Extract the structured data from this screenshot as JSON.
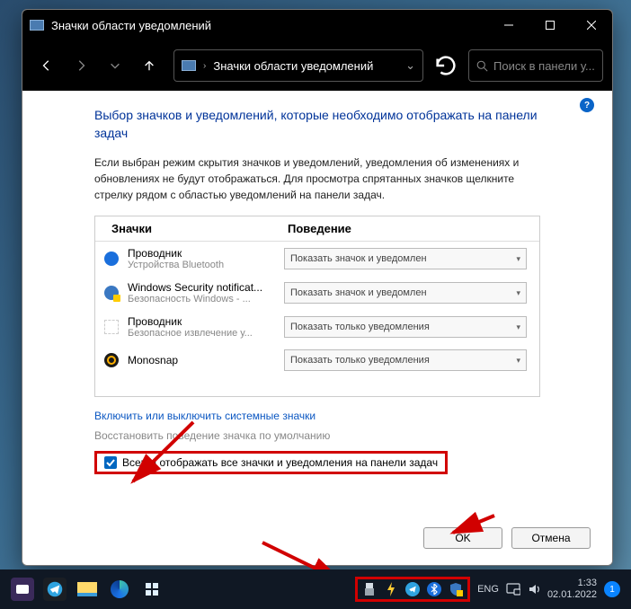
{
  "window": {
    "title": "Значки области уведомлений"
  },
  "nav": {
    "address": "Значки области уведомлений",
    "search_placeholder": "Поиск в панели у..."
  },
  "heading": "Выбор значков и уведомлений, которые необходимо отображать на панели задач",
  "description": "Если выбран режим скрытия значков и уведомлений, уведомления об изменениях и обновлениях не будут отображаться. Для просмотра спрятанных значков щелкните стрелку рядом с областью уведомлений на панели задач.",
  "columns": {
    "c1": "Значки",
    "c2": "Поведение"
  },
  "rows": [
    {
      "name": "Проводник",
      "sub": "Устройства Bluetooth",
      "sel": "Показать значок и уведомлен",
      "icon": "bluetooth"
    },
    {
      "name": "Windows Security notificat...",
      "sub": "Безопасность Windows - ...",
      "sel": "Показать значок и уведомлен",
      "icon": "shield"
    },
    {
      "name": "Проводник",
      "sub": "Безопасное извлечение у...",
      "sel": "Показать только уведомления",
      "icon": "blank"
    },
    {
      "name": "Monosnap",
      "sub": "",
      "sel": "Показать только уведомления",
      "icon": "mono"
    }
  ],
  "links": {
    "l1": "Включить или выключить системные значки",
    "l2": "Восстановить поведение значка по умолчанию"
  },
  "checkbox_label": "Всегда отображать все значки и уведомления на панели задач",
  "buttons": {
    "ok": "OK",
    "cancel": "Отмена"
  },
  "taskbar": {
    "lang": "ENG",
    "time": "1:33",
    "date": "02.01.2022",
    "notif_count": "1"
  }
}
